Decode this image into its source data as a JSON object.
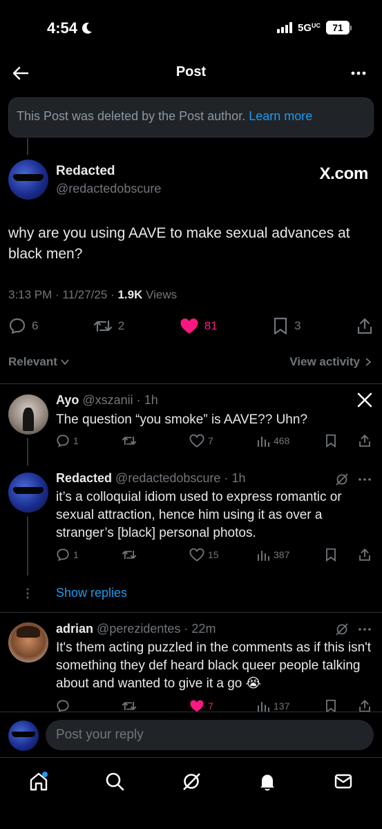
{
  "status_bar": {
    "time": "4:54",
    "network": "5G",
    "network_sub": "UC",
    "battery": "71"
  },
  "nav": {
    "title": "Post"
  },
  "deleted_notice": {
    "text": "This Post was deleted by the Post author.",
    "link": "Learn more"
  },
  "main_post": {
    "author_name": "Redacted",
    "author_handle": "@redactedobscure",
    "badge": "X.com",
    "text": "why are you using AAVE to make sexual advances at black men?",
    "time": "3:13 PM",
    "date": "11/27/25",
    "views_count": "1.9K",
    "views_label": "Views",
    "replies": "6",
    "reposts": "2",
    "likes": "81",
    "bookmarks": "3"
  },
  "sort": {
    "label": "Relevant",
    "activity": "View activity"
  },
  "replies": [
    {
      "name": "Ayo",
      "handle": "@xszanii",
      "age": "1h",
      "text": "The question “you smoke” is AAVE?? Uhn?",
      "replies": "1",
      "likes": "7",
      "views": "468"
    },
    {
      "name": "Redacted",
      "handle": "@redactedobscure",
      "age": "1h",
      "text": "it’s a colloquial idiom used to express romantic or sexual attraction, hence him using it as over a stranger’s [black] personal photos.",
      "replies": "1",
      "likes": "15",
      "views": "387"
    },
    {
      "name": "adrian",
      "handle": "@perezidentes",
      "age": "22m",
      "text": "It's them acting puzzled in the comments as if this isn't something they def heard black queer people talking about and wanted to give it a go 😭",
      "likes": "7",
      "views": "137"
    }
  ],
  "show_replies": "Show replies",
  "reply_bar": {
    "placeholder": "Post your reply"
  },
  "colors": {
    "accent": "#1d9bf0",
    "like": "#f91880",
    "muted": "#71767b",
    "bg": "#000000"
  },
  "tabs": [
    "home-icon",
    "search-icon",
    "grok-icon",
    "notifications-icon",
    "messages-icon"
  ]
}
